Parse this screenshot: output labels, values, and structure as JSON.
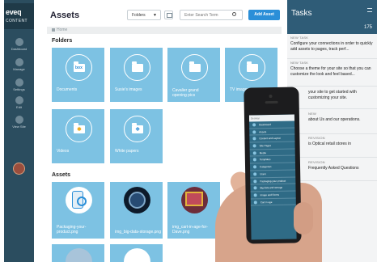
{
  "nav": {
    "logo": "eveq",
    "logo_sub": "CONTENT",
    "items": [
      {
        "label": "Dashboard",
        "icon": "dashboard-icon"
      },
      {
        "label": "Manage",
        "icon": "manage-icon"
      },
      {
        "label": "Settings",
        "icon": "gear-icon"
      },
      {
        "label": "Edit",
        "icon": "pencil-icon"
      },
      {
        "label": "View Site",
        "icon": "eye-icon"
      }
    ]
  },
  "header": {
    "title": "Assets",
    "select_value": "Folders",
    "search_placeholder": "Enter Search Term",
    "add_label": "Add Asset"
  },
  "breadcrumb": "Home",
  "folders_heading": "Folders",
  "folders": [
    {
      "label": "Documents",
      "icon": "box"
    },
    {
      "label": "Susie's images",
      "icon": "folder"
    },
    {
      "label": "Cavalier grand opening pics",
      "icon": "folder"
    },
    {
      "label": "TV images",
      "icon": "folder"
    },
    {
      "label": "Videos",
      "icon": "gear"
    },
    {
      "label": "White papers",
      "icon": "drop"
    }
  ],
  "assets_heading": "Assets",
  "assets": [
    {
      "label": "Packaging-your-product.png"
    },
    {
      "label": "img_big-data-storage.png"
    },
    {
      "label": "img_cart-in-age-for-Dave.png"
    }
  ],
  "tasks": {
    "title": "Tasks",
    "count": "175",
    "items": [
      {
        "tag": "NEW TASK",
        "text": "Configure your connections in order to quickly add assets to pages, track perf..."
      },
      {
        "tag": "NEW TASK",
        "text": "Choose a theme for your site so that you can customize the look and feel based..."
      },
      {
        "tag": "",
        "text": "your site to get started with customizing your site."
      },
      {
        "tag": "NEW",
        "text": "about Us and our operations."
      },
      {
        "tag": "REVISION",
        "text": "is Optical retail stores in"
      },
      {
        "tag": "REVISION",
        "text": "Frequently Asked Questions"
      }
    ]
  },
  "phone": {
    "header": "Desktop",
    "rows": [
      "Dashboard",
      "Assets",
      "Content and Layout",
      "Site Pages",
      "Media",
      "Templates",
      "Categories",
      "Users",
      "Packaging-your-product",
      "Big data and storage",
      "Image and Forms",
      "Cart in age"
    ]
  },
  "colors": {
    "nav": "#2b4d5f",
    "tile": "#7dc2e3",
    "accent": "#2b8fd8",
    "tasks_header": "#2f5c77"
  }
}
